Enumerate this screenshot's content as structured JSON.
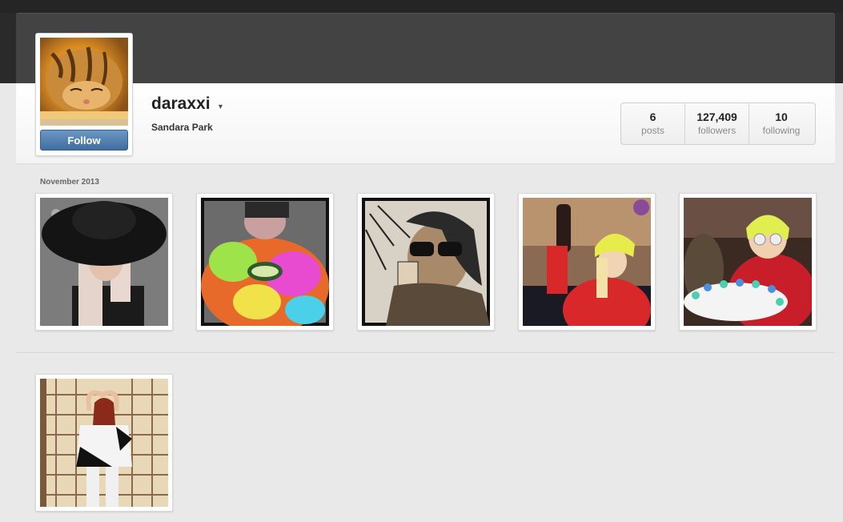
{
  "profile": {
    "username": "daraxxi",
    "full_name": "Sandara Park",
    "follow_label": "Follow"
  },
  "stats": [
    {
      "value": "6",
      "label": "posts"
    },
    {
      "value": "127,409",
      "label": "followers"
    },
    {
      "value": "10",
      "label": "following"
    }
  ],
  "month_label": "November 2013",
  "icons": {
    "dropdown": "caret-down-icon"
  },
  "colors": {
    "follow_button": "#4f7fb0",
    "header_dark": "#434343",
    "page_bg": "#e9e9e9"
  }
}
